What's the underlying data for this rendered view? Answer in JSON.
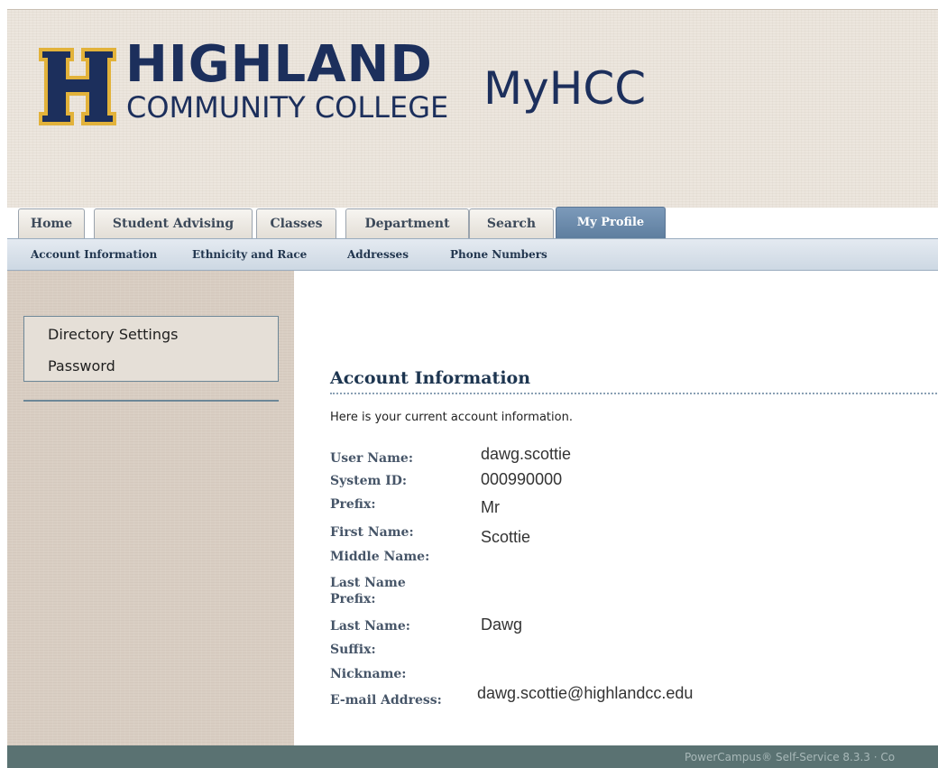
{
  "brand": {
    "letter": "H",
    "name": "HIGHLAND",
    "subtitle": "COMMUNITY COLLEGE",
    "portal": "MyHCC",
    "colors": {
      "navy": "#1c2f5c",
      "gold": "#e2b23a"
    }
  },
  "tabs": [
    {
      "label": "Home"
    },
    {
      "label": "Student Advising"
    },
    {
      "label": "Classes"
    },
    {
      "label": "Department"
    },
    {
      "label": "Search"
    },
    {
      "label": "My Profile",
      "active": true
    }
  ],
  "subnav": [
    {
      "label": "Account Information"
    },
    {
      "label": "Ethnicity and Race"
    },
    {
      "label": "Addresses"
    },
    {
      "label": "Phone Numbers"
    }
  ],
  "sidebar": {
    "links": [
      {
        "label": "Directory Settings"
      },
      {
        "label": "Password"
      }
    ]
  },
  "main": {
    "title": "Account Information",
    "intro": "Here is your current account information.",
    "fields": [
      {
        "label": "User Name:",
        "value": "dawg.scottie"
      },
      {
        "label": "System ID:",
        "value": "000990000"
      },
      {
        "label": "Prefix:",
        "value": "Mr"
      },
      {
        "label": "First Name:",
        "value": "Scottie"
      },
      {
        "label": "Middle Name:",
        "value": ""
      },
      {
        "label": "Last Name Prefix:",
        "value": ""
      },
      {
        "label": "Last Name:",
        "value": "Dawg"
      },
      {
        "label": "Suffix:",
        "value": ""
      },
      {
        "label": "Nickname:",
        "value": ""
      },
      {
        "label": "E-mail Address:",
        "value": "dawg.scottie@highlandcc.edu"
      }
    ]
  },
  "footer": {
    "text": "PowerCampus® Self-Service 8.3.3 · Co"
  }
}
